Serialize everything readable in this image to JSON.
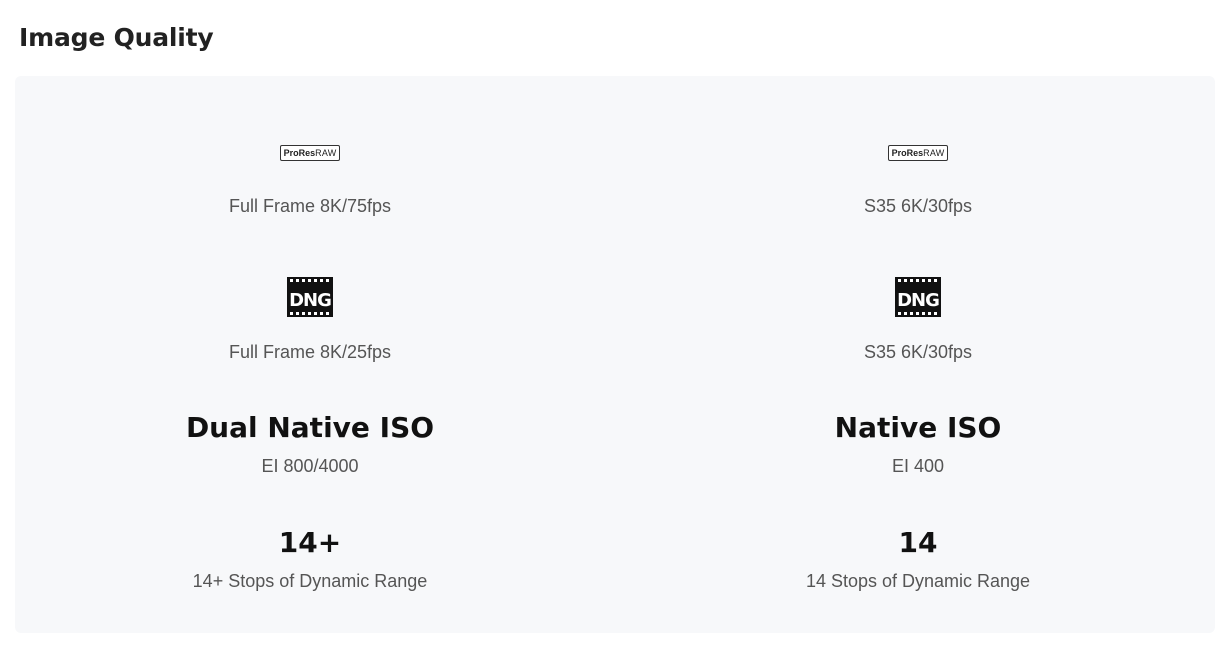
{
  "header": {
    "title": "Image Quality"
  },
  "columns": [
    {
      "prores": {
        "brand": "ProRes",
        "suffix": "RAW",
        "spec": "Full Frame 8K/75fps"
      },
      "dng": {
        "label": "DNG",
        "spec": "Full Frame 8K/25fps"
      },
      "iso": {
        "title": "Dual Native ISO",
        "value": "EI 800/4000"
      },
      "dynamic_range": {
        "value": "14+",
        "description": "14+ Stops of Dynamic Range"
      }
    },
    {
      "prores": {
        "brand": "ProRes",
        "suffix": "RAW",
        "spec": "S35 6K/30fps"
      },
      "dng": {
        "label": "DNG",
        "spec": "S35 6K/30fps"
      },
      "iso": {
        "title": "Native ISO",
        "value": "EI 400"
      },
      "dynamic_range": {
        "value": "14",
        "description": "14 Stops of Dynamic Range"
      }
    }
  ],
  "colors": {
    "panel_bg": "#f7f8fa",
    "title": "#222222",
    "spec_text": "#555555",
    "big_text": "#111111"
  },
  "icons": {
    "prores": "prores-raw-icon",
    "dng": "dng-film-icon"
  }
}
